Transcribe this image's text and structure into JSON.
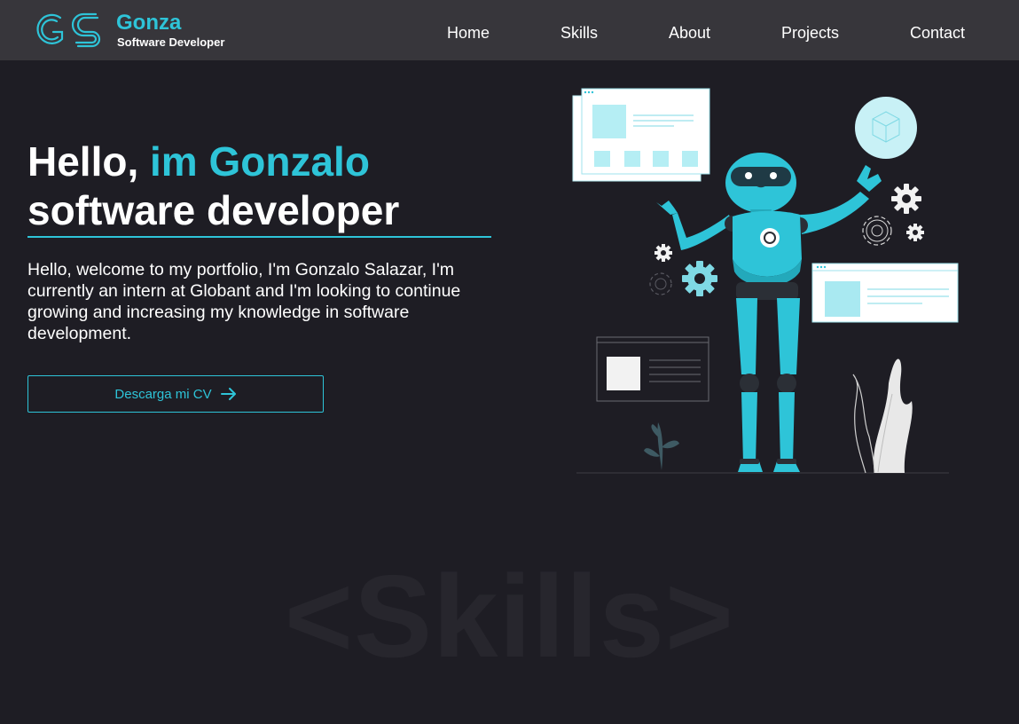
{
  "brand": {
    "name": "Gonza",
    "role": "Software Developer"
  },
  "nav": {
    "items": [
      "Home",
      "Skills",
      "About",
      "Projects",
      "Contact"
    ]
  },
  "hero": {
    "title_prefix": "Hello,",
    "title_accent": "im Gonzalo",
    "title_line2": "software developer",
    "description": "Hello, welcome to my portfolio, I'm Gonzalo Salazar, I'm currently an intern at Globant and I'm looking to continue growing and increasing my knowledge in software development.",
    "cv_button": "Descarga mi CV"
  },
  "skills_section": {
    "watermark": "<Skills>"
  },
  "colors": {
    "accent": "#2ec4d8",
    "navbar": "#37363b",
    "background": "#1e1d24"
  },
  "icons": [
    "gs-logo",
    "arrow-right-icon",
    "robot-illustration",
    "gear-icon"
  ]
}
